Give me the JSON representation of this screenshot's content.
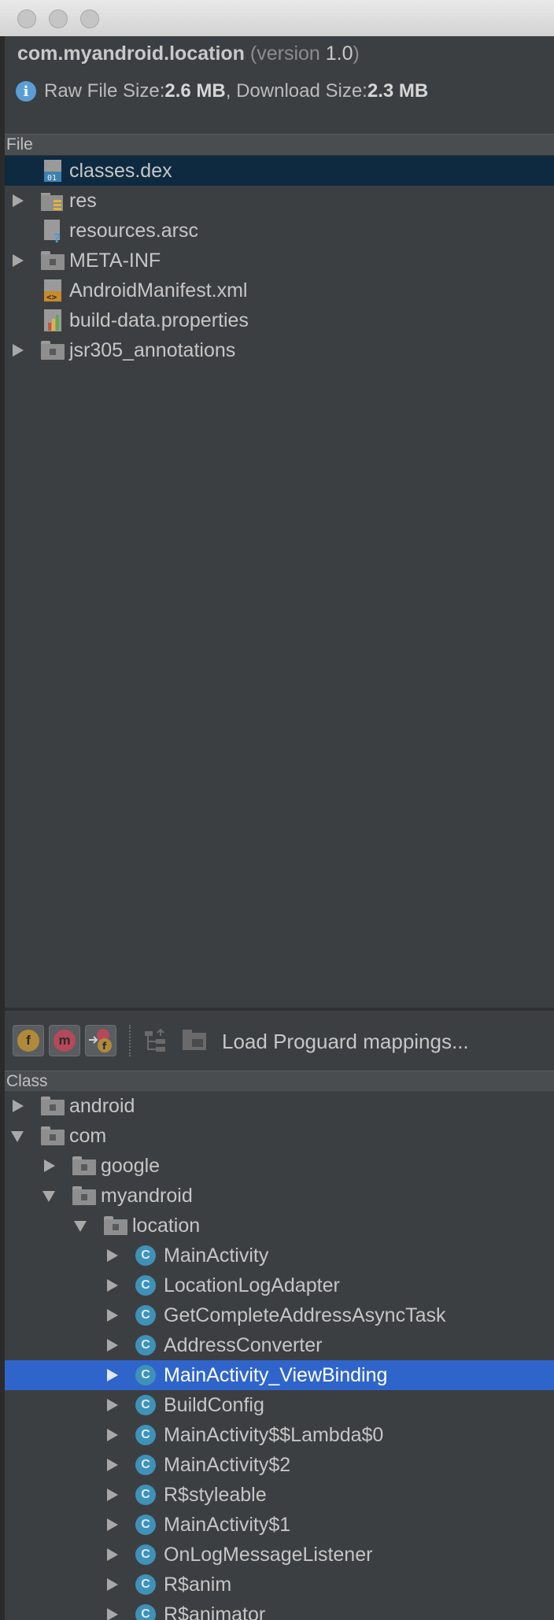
{
  "window": {
    "package": "com.myandroid.location",
    "version_prefix": "(version ",
    "version": "1.0",
    "version_suffix": ")"
  },
  "sizes": {
    "raw_label": "Raw File Size: ",
    "raw_value": "2.6 MB",
    "sep": ", ",
    "download_label": "Download Size: ",
    "download_value": "2.3 MB"
  },
  "file_panel": {
    "header": "File",
    "items": [
      {
        "label": "classes.dex",
        "icon": "dex-file-icon",
        "selected": true
      },
      {
        "label": "res",
        "icon": "res-folder-icon"
      },
      {
        "label": "resources.arsc",
        "icon": "unknown-file-icon"
      },
      {
        "label": "META-INF",
        "icon": "folder-icon"
      },
      {
        "label": "AndroidManifest.xml",
        "icon": "xml-file-icon"
      },
      {
        "label": "build-data.properties",
        "icon": "properties-file-icon"
      },
      {
        "label": "jsr305_annotations",
        "icon": "folder-icon"
      }
    ]
  },
  "toolbar": {
    "load_label": "Load Proguard mappings...",
    "field_glyph": "f",
    "method_glyph": "m"
  },
  "class_panel": {
    "header": "Class",
    "class_glyph": "C",
    "items": [
      {
        "label": "android"
      },
      {
        "label": "com"
      },
      {
        "label": "google"
      },
      {
        "label": "myandroid"
      },
      {
        "label": "location"
      },
      {
        "label": "MainActivity"
      },
      {
        "label": "LocationLogAdapter"
      },
      {
        "label": "GetCompleteAddressAsyncTask"
      },
      {
        "label": "AddressConverter"
      },
      {
        "label": "MainActivity_ViewBinding",
        "selected": true
      },
      {
        "label": "BuildConfig"
      },
      {
        "label": "MainActivity$$Lambda$0"
      },
      {
        "label": "MainActivity$2"
      },
      {
        "label": "R$styleable"
      },
      {
        "label": "MainActivity$1"
      },
      {
        "label": "OnLogMessageListener"
      },
      {
        "label": "R$anim"
      },
      {
        "label": "R$animator"
      }
    ]
  },
  "colors": {
    "background": "#3c3f41",
    "selection_blue": "#2f65ca",
    "selection_dark": "#0e2a40",
    "class_icon": "#3f91b8",
    "info_icon": "#5b9ed6"
  }
}
